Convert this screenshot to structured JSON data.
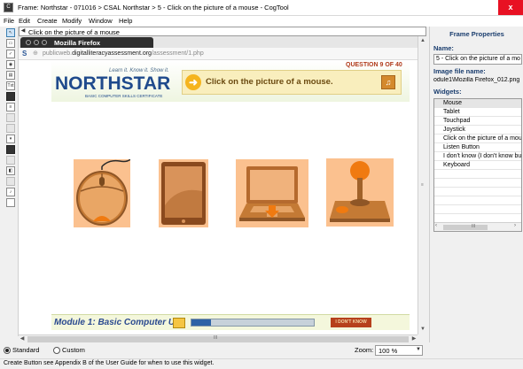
{
  "window": {
    "app_icon": "app-icon",
    "title": "Frame: Northstar - 071016 > CSAL Northstar > 5 - Click on the picture of a mouse - CogTool",
    "close": "x"
  },
  "menu": [
    "File",
    "Edit",
    "Create",
    "Modify",
    "Window",
    "Help"
  ],
  "frame_strip": {
    "icon": "speaker-icon",
    "name": "Click on the picture of a mouse"
  },
  "browser": {
    "tab_title": "Mozilla Firefox",
    "url_base": "publicweb.",
    "url_domain": "digitalliteracyassessment.org",
    "url_path": "/assessment/1.php"
  },
  "page": {
    "tagline": "Learn it. Know it. Show it.",
    "logo": "NORTHSTAR",
    "logo_sub": "BASIC COMPUTER SKILLS CERTIFICATE",
    "question": "QUESTION 9 OF 40",
    "instruction": "Click on the picture of a mouse.",
    "devices": [
      "mouse",
      "tablet",
      "laptop",
      "joystick"
    ],
    "module_title": "Module 1: Basic Computer Use",
    "progress": 0.16,
    "dont_know": "I DON'T KNOW"
  },
  "panel": {
    "title": "Frame Properties",
    "name_label": "Name:",
    "name_value": "5 - Click on the picture of a mo",
    "image_label": "Image file name:",
    "image_value": "odule1\\Mozilla Firefox_012.png",
    "widgets_label": "Widgets:",
    "widgets": [
      "Mouse",
      "Tablet",
      "Touchpad",
      "Joystick",
      "Click on the picture of a mou",
      "Listen Button",
      "I don't know (I don't know bu",
      "Keyboard"
    ]
  },
  "view": {
    "standard": "Standard",
    "custom": "Custom",
    "selected_mode": "Standard",
    "zoom_label": "Zoom:",
    "zoom_value": "100 %"
  },
  "status": "Create Button see Appendix B of the User Guide for when to use this widget.",
  "colors": {
    "logo_blue": "#1f4a8c",
    "instruction_bg": "#f9eebd",
    "device_bg": "#fbc18f",
    "close_red": "#e81123"
  }
}
